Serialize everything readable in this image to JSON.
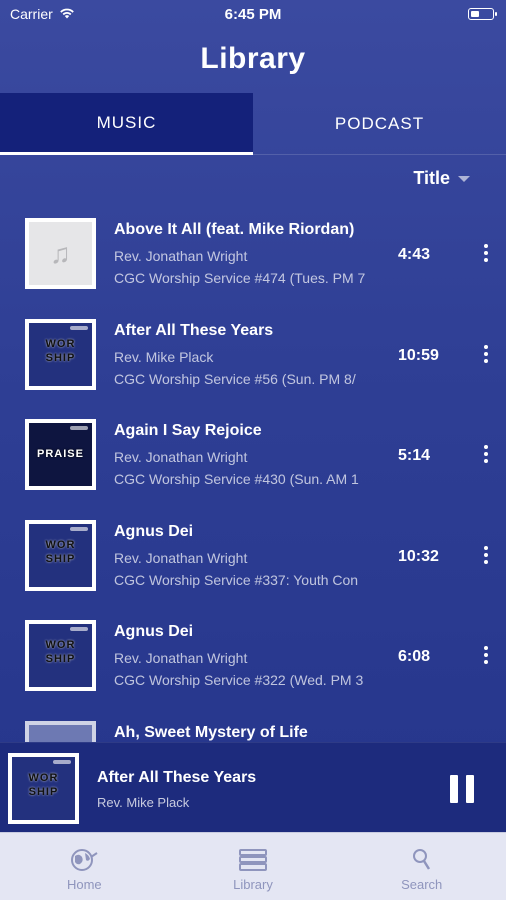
{
  "status_bar": {
    "carrier": "Carrier",
    "time": "6:45 PM"
  },
  "page": {
    "title": "Library"
  },
  "tabs": [
    {
      "label": "MUSIC",
      "active": true
    },
    {
      "label": "PODCAST",
      "active": false
    }
  ],
  "sort": {
    "label": "Title"
  },
  "songs": [
    {
      "title": "Above It All (feat. Mike Riordan)",
      "artist": "Rev. Jonathan Wright",
      "album": "CGC Worship Service #474 (Tues. PM 7",
      "duration": "4:43",
      "art": "music-placeholder"
    },
    {
      "title": "After All These Years",
      "artist": "Rev. Mike Plack",
      "album": "CGC Worship Service #56 (Sun. PM 8/",
      "duration": "10:59",
      "art": "worship"
    },
    {
      "title": "Again I Say Rejoice",
      "artist": "Rev. Jonathan Wright",
      "album": "CGC Worship Service #430 (Sun. AM 1",
      "duration": "5:14",
      "art": "praise"
    },
    {
      "title": "Agnus Dei",
      "artist": "Rev. Jonathan Wright",
      "album": "CGC Worship Service #337: Youth Con",
      "duration": "10:32",
      "art": "worship"
    },
    {
      "title": "Agnus Dei",
      "artist": "Rev. Jonathan Wright",
      "album": "CGC Worship Service #322 (Wed. PM 3",
      "duration": "6:08",
      "art": "worship"
    },
    {
      "title": "Ah, Sweet Mystery of Life",
      "artist": "",
      "album": "",
      "duration": "",
      "art": "worship"
    }
  ],
  "art_text": {
    "worship": "WOR SHIP",
    "praise": "PRAISE"
  },
  "now_playing": {
    "title": "After All These Years",
    "artist": "Rev. Mike Plack"
  },
  "tabbar": [
    {
      "label": "Home",
      "icon": "globe-icon"
    },
    {
      "label": "Library",
      "icon": "books-icon"
    },
    {
      "label": "Search",
      "icon": "search-icon"
    }
  ],
  "colors": {
    "background": "#2f3f95",
    "active_tab": "#14217a",
    "player": "#1d2b7d",
    "tabbar": "#e4e6f3",
    "tabbar_text": "#8f95bd"
  }
}
